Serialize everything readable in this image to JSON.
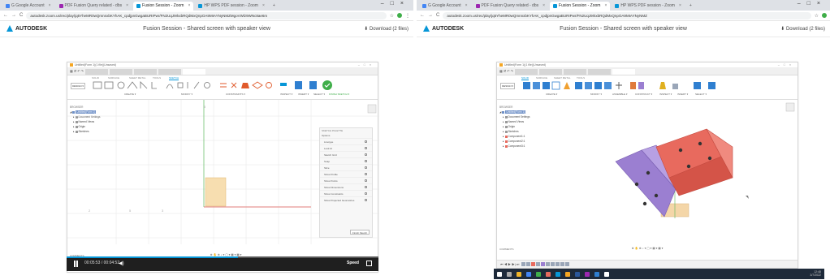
{
  "left": {
    "tabs": [
      {
        "label": "G Google Account",
        "color": "#4285f4",
        "active": false
      },
      {
        "label": "PDF Fusion Query related - dbs",
        "color": "#9c27b0",
        "active": false
      },
      {
        "label": "Fusion Session - Zoom",
        "color": "#0696d7",
        "active": true
      },
      {
        "label": "HP WPS PDF session - Zoom",
        "color": "#0696d7",
        "active": false
      }
    ],
    "url": "autodesk.zoom.us/rec/play/jq5YheMR0wQmnnxbKYhAK_cpdjpnGwgaBURIPwr/FN2UqJ9rkxbRQdMxQnpOA9MIAYNyNMZMgoVWlz9WNc8ae6m",
    "brand": "AUTODESK",
    "page_title": "Fusion Session - Shared screen with speaker view",
    "download": "Download (2 files)",
    "fusion": {
      "title": "Untitled(Form 1)(1 file)(Unsaved)",
      "ribbon_tabs": [
        "SOLID",
        "SURFACE",
        "SHEET METAL",
        "TOOLS",
        "SKETCH"
      ],
      "active_tab": "SKETCH",
      "toolbar_groups": [
        "DESIGN ▾",
        "CREATE ▾",
        "MODIFY ▾",
        "CONSTRAINTS ▾",
        "INSPECT ▾",
        "INSERT ▾",
        "SELECT ▾",
        "FINISH SKETCH ▾"
      ],
      "browser_title": "BROWSER",
      "browser_rows": [
        "Untitled(Form 1)",
        "Document Settings",
        "Named Views",
        "Origin",
        "Sketches"
      ],
      "palette_title": "SKETCH PALETTE",
      "palette_header": "Options",
      "palette_rows": [
        "Linetype",
        "Look At",
        "Sketch Grid",
        "Snap",
        "Slice",
        "Show Profile",
        "Show Points",
        "Show Dimensions",
        "Show Constraints",
        "Show Projected Geometries"
      ],
      "palette_button": "Finish Sketch",
      "comments": "COMMENTS"
    },
    "video": {
      "time": "00:05:53 / 00:04:52",
      "speed": "Speed",
      "progress": 0.55
    }
  },
  "right": {
    "tabs": [
      {
        "label": "G Google Account",
        "color": "#4285f4",
        "active": false
      },
      {
        "label": "PDF Fusion Query related - dbs",
        "color": "#9c27b0",
        "active": false
      },
      {
        "label": "Fusion Session - Zoom",
        "color": "#0696d7",
        "active": true
      },
      {
        "label": "HP WPS PDF session - Zoom",
        "color": "#0696d7",
        "active": false
      }
    ],
    "url": "autodesk.zoom.us/rec/play/jq5YheMR0wQmnnxbKYhAK_cpdjpnGwgaBURIPwr/FN2UqJ9rkxbRQdMxQnpOA9MIAYNyNMZ",
    "brand": "AUTODESK",
    "page_title": "Fusion Session - Shared screen with speaker view",
    "download": "Download (2 files)",
    "fusion": {
      "title": "Untitled(Form 1)(1 file)(Unsaved)",
      "ribbon_tabs": [
        "SOLID",
        "SURFACE",
        "SHEET METAL",
        "TOOLS"
      ],
      "active_tab": "SOLID",
      "toolbar_groups": [
        "DESIGN ▾",
        "CREATE ▾",
        "MODIFY ▾",
        "ASSEMBLE ▾",
        "CONSTRUCT ▾",
        "INSPECT ▾",
        "INSERT ▾",
        "SELECT ▾"
      ],
      "browser_title": "BROWSER",
      "browser_rows": [
        "Untitled(Form 1)",
        "Document Settings",
        "Named Views",
        "Origin",
        "Sketches",
        "Component1:1",
        "Component2:1",
        "Component3:1"
      ],
      "comments": "COMMENTS"
    },
    "taskbar_clock": [
      "12:48",
      "3/7/2022"
    ]
  },
  "colors": {
    "adsk_blue": "#0696d7",
    "sketch_fill": "#f7deb0",
    "bracket_purple": "#9b7fd1",
    "plate_red": "#e86a5e",
    "finish_green": "#3fae49"
  }
}
